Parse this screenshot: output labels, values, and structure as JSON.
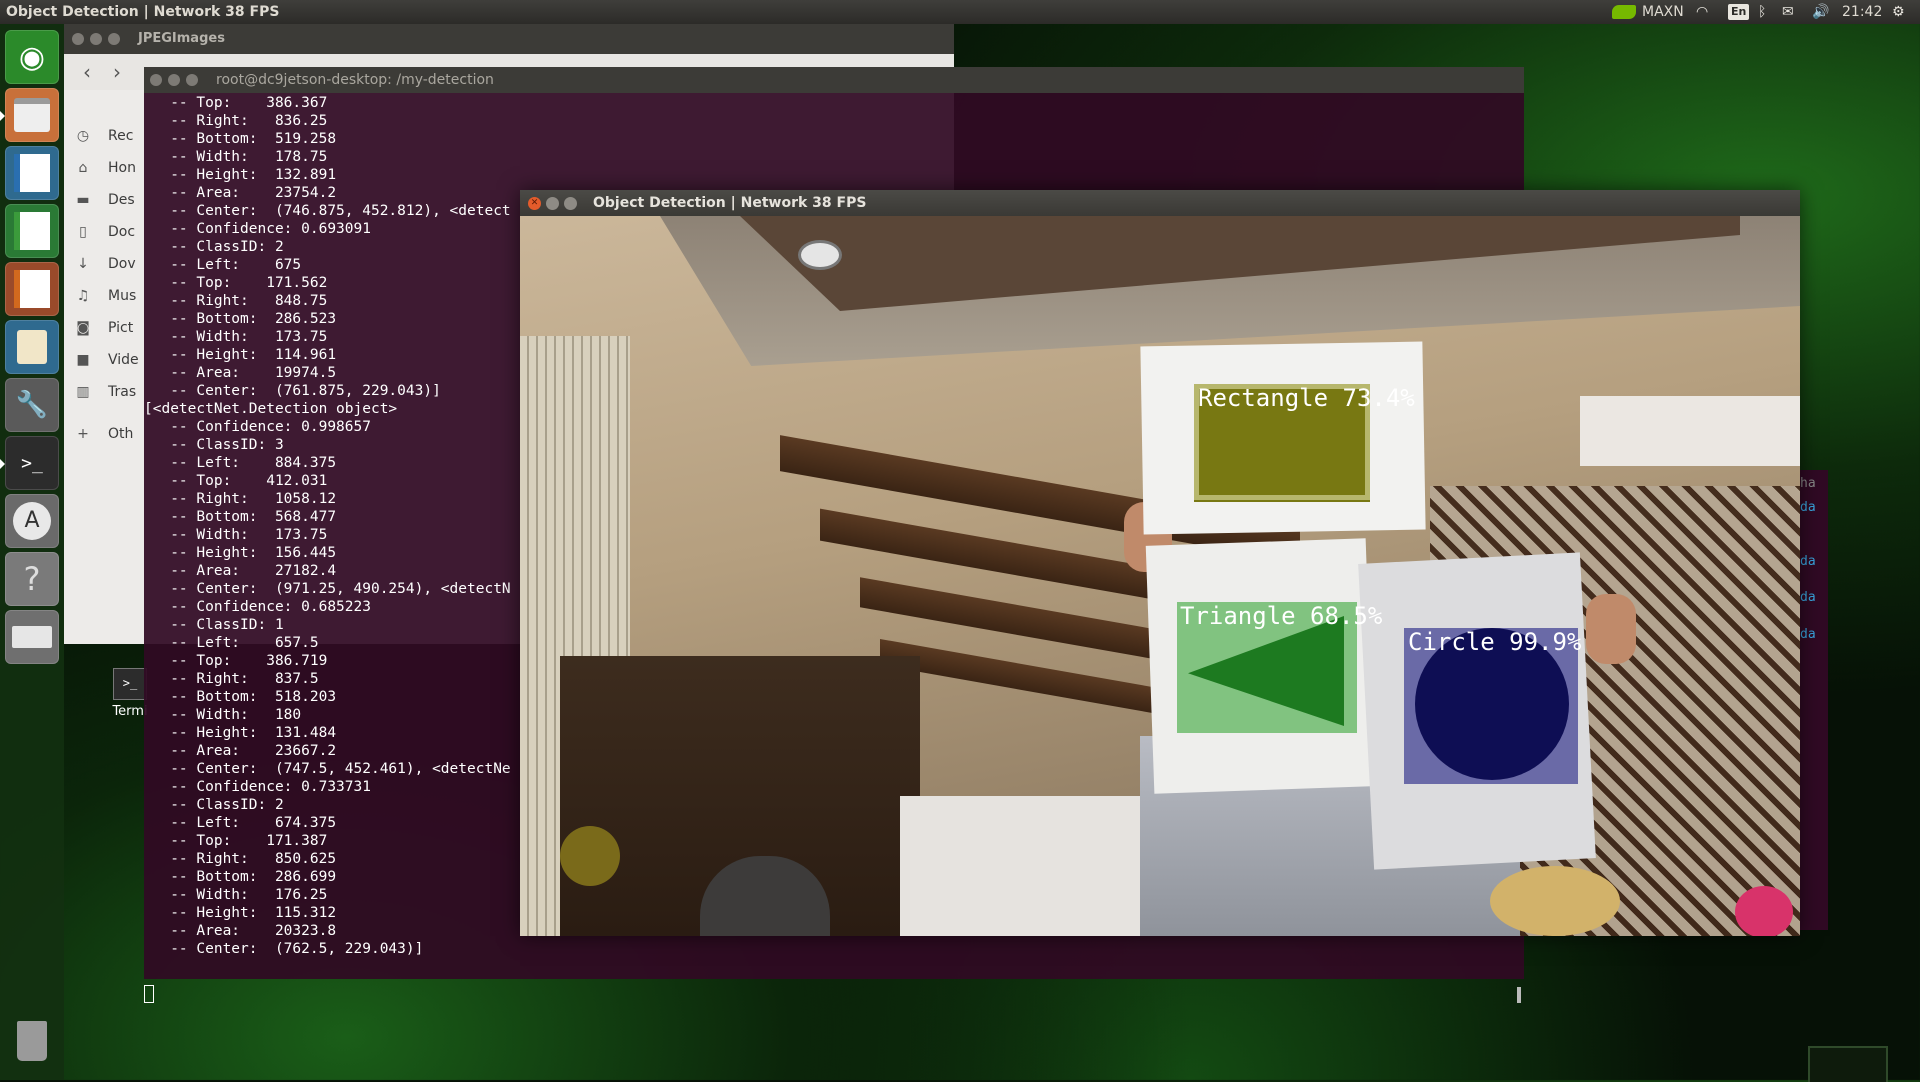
{
  "top_panel": {
    "title": "Object Detection | Network 38 FPS",
    "power_mode": "MAXN",
    "keyboard_layout": "En",
    "clock": "21:42"
  },
  "launcher": {
    "items": [
      "ubuntu-dash",
      "files",
      "writer",
      "calc",
      "impress",
      "software-center",
      "system-settings",
      "terminal",
      "software-updater",
      "help",
      "drive",
      "trash"
    ]
  },
  "files_window": {
    "title": "JPEGImages",
    "sidebar": [
      {
        "label": "Rec",
        "icon": "clock-icon"
      },
      {
        "label": "Hon",
        "icon": "home-icon"
      },
      {
        "label": "Des",
        "icon": "folder-icon"
      },
      {
        "label": "Doc",
        "icon": "document-icon"
      },
      {
        "label": "Dov",
        "icon": "download-icon"
      },
      {
        "label": "Mus",
        "icon": "music-icon"
      },
      {
        "label": "Pict",
        "icon": "camera-icon"
      },
      {
        "label": "Vide",
        "icon": "video-icon"
      },
      {
        "label": "Tras",
        "icon": "trash-icon"
      },
      {
        "label": "Oth",
        "icon": "plus-icon"
      }
    ]
  },
  "desktop_icon": {
    "label": "Termi"
  },
  "terminal": {
    "title": "root@dc9jetson-desktop: /my-detection",
    "lines": [
      "   -- Top:    386.367",
      "   -- Right:   836.25",
      "   -- Bottom:  519.258",
      "   -- Width:   178.75",
      "   -- Height:  132.891",
      "   -- Area:    23754.2",
      "   -- Center:  (746.875, 452.812), <detect",
      "   -- Confidence: 0.693091",
      "   -- ClassID: 2",
      "   -- Left:    675",
      "   -- Top:    171.562",
      "   -- Right:   848.75",
      "   -- Bottom:  286.523",
      "   -- Width:   173.75",
      "   -- Height:  114.961",
      "   -- Area:    19974.5",
      "   -- Center:  (761.875, 229.043)]",
      "[<detectNet.Detection object>",
      "   -- Confidence: 0.998657",
      "   -- ClassID: 3",
      "   -- Left:    884.375",
      "   -- Top:    412.031",
      "   -- Right:   1058.12",
      "   -- Bottom:  568.477",
      "   -- Width:   173.75",
      "   -- Height:  156.445",
      "   -- Area:    27182.4",
      "   -- Center:  (971.25, 490.254), <detectN",
      "   -- Confidence: 0.685223",
      "   -- ClassID: 1",
      "   -- Left:    657.5",
      "   -- Top:    386.719",
      "   -- Right:   837.5",
      "   -- Bottom:  518.203",
      "   -- Width:   180",
      "   -- Height:  131.484",
      "   -- Area:    23667.2",
      "   -- Center:  (747.5, 452.461), <detectNe",
      "   -- Confidence: 0.733731",
      "   -- ClassID: 2",
      "   -- Left:    674.375",
      "   -- Top:    171.387",
      "   -- Right:   850.625",
      "   -- Bottom:  286.699",
      "   -- Width:   176.25",
      "   -- Height:  115.312",
      "   -- Area:    20323.8",
      "   -- Center:  (762.5, 229.043)]"
    ]
  },
  "detection_window": {
    "title": "Object Detection | Network 38 FPS",
    "detections": [
      {
        "label": "Rectangle 73.4%",
        "color": "#787812"
      },
      {
        "label": "Triangle 68.5%",
        "color": "#28a028"
      },
      {
        "label": "Circle 99.9%",
        "color": "#14147e"
      }
    ]
  },
  "side_window": {
    "fragments": [
      "ha",
      "da",
      "da",
      "da",
      "da"
    ]
  },
  "colors": {
    "terminal_bg": "#300a24",
    "panel_bg": "#3c3b37",
    "nvidia_green": "#76b900",
    "close_orange": "#e35b2b"
  }
}
